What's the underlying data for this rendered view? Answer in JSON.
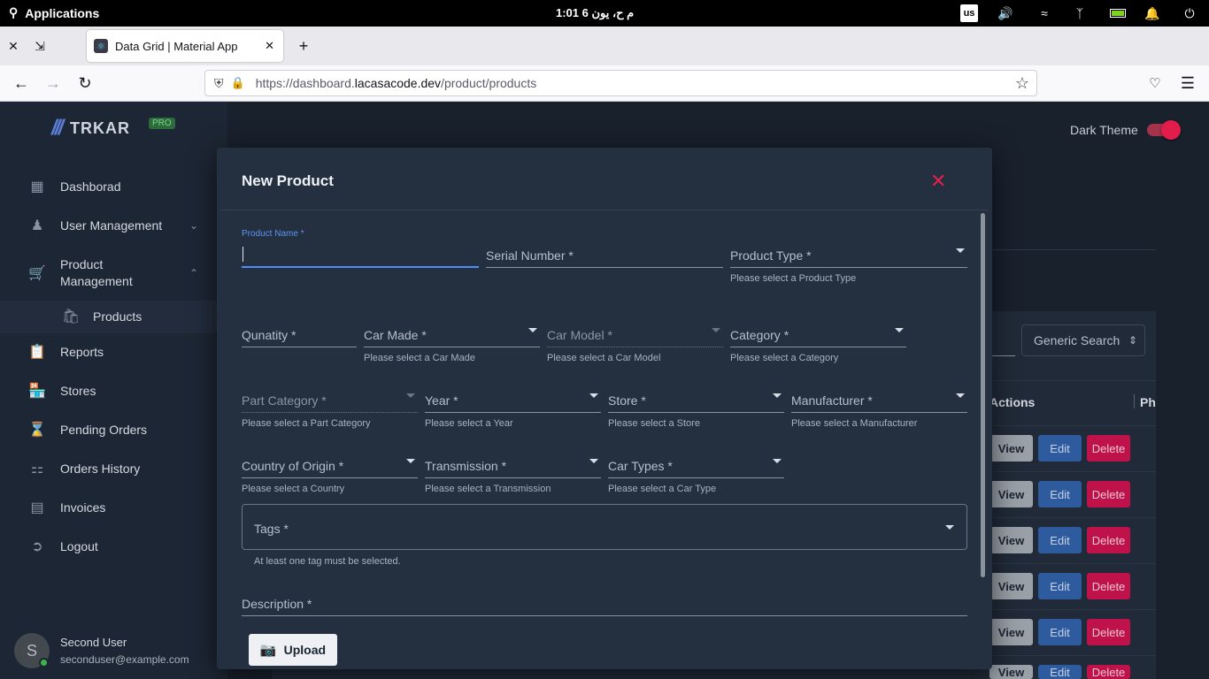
{
  "system": {
    "apps_label": "Applications",
    "clock": "1:01 م   ح، يون  6",
    "keyboard": "us"
  },
  "browser": {
    "tab_title": "Data Grid | Material App",
    "url_prefix": "https://dashboard.",
    "url_domain": "lacasacode.dev",
    "url_path": "/product/products"
  },
  "sidebar": {
    "brand": "TRKAR",
    "badge": "PRO",
    "items": [
      {
        "label": "Dashborad",
        "icon": "dashboard-icon"
      },
      {
        "label": "User Management",
        "icon": "people-icon"
      },
      {
        "label": "Product\nManagement",
        "icon": "cart-icon"
      },
      {
        "label": "Products",
        "icon": "bag-icon"
      },
      {
        "label": "Reports",
        "icon": "clipboard-icon"
      },
      {
        "label": "Stores",
        "icon": "store-icon"
      },
      {
        "label": "Pending Orders",
        "icon": "hourglass-icon"
      },
      {
        "label": "Orders History",
        "icon": "basket-icon"
      },
      {
        "label": "Invoices",
        "icon": "list-icon"
      },
      {
        "label": "Logout",
        "icon": "logout-icon"
      }
    ],
    "user": {
      "initial": "S",
      "name": "Second User",
      "email": "seconduser@example.com"
    }
  },
  "main": {
    "dark_theme_label": "Dark Theme",
    "dark_theme_on": true,
    "generic_search": "Generic Search",
    "col_actions": "Actions",
    "col_ph": "Ph",
    "row_view": "View",
    "row_edit": "Edit",
    "row_delete": "Delete"
  },
  "modal": {
    "title": "New Product",
    "fields": {
      "product_name": {
        "label": "Product Name *"
      },
      "serial_number": {
        "label": "Serial Number *"
      },
      "product_type": {
        "label": "Product Type *",
        "hint": "Please select a Product Type"
      },
      "quantity": {
        "label": "Qunatity *"
      },
      "car_made": {
        "label": "Car Made *",
        "hint": "Please select a Car Made"
      },
      "car_model": {
        "label": "Car Model *",
        "hint": "Please select a Car Model"
      },
      "category": {
        "label": "Category *",
        "hint": "Please select a Category"
      },
      "part_category": {
        "label": "Part Category *",
        "hint": "Please select a Part Category"
      },
      "year": {
        "label": "Year *",
        "hint": "Please select a Year"
      },
      "store": {
        "label": "Store *",
        "hint": "Please select a Store"
      },
      "manufacturer": {
        "label": "Manufacturer *",
        "hint": "Please select a Manufacturer"
      },
      "country": {
        "label": "Country of Origin *",
        "hint": "Please select a Country"
      },
      "transmission": {
        "label": "Transmission *",
        "hint": "Please select a Transmission"
      },
      "car_types": {
        "label": "Car Types *",
        "hint": "Please select a Car Type"
      },
      "tags": {
        "label": "Tags *",
        "hint": "At least one tag must be selected."
      },
      "description": {
        "label": "Description *"
      }
    },
    "upload_label": "Upload"
  }
}
